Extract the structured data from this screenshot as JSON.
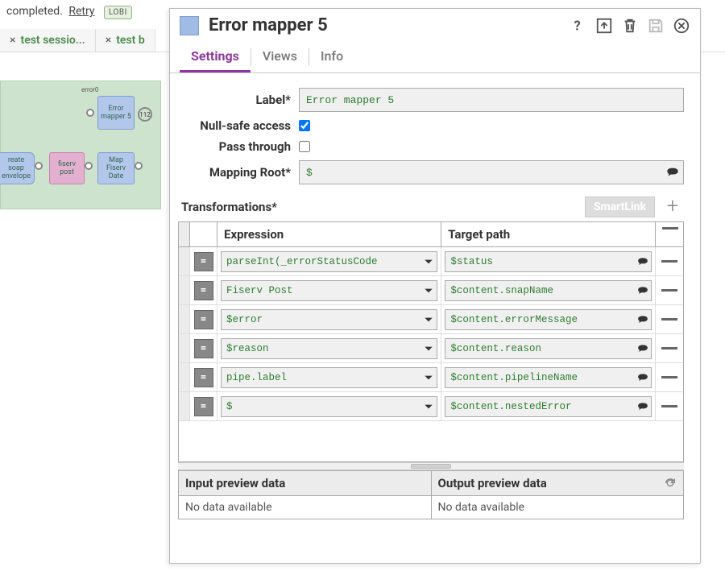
{
  "background": {
    "status_prefix": "completed.",
    "retry": "Retry",
    "lob_badge": "LOBI",
    "tabs": [
      {
        "label": "test sessio...",
        "closeable": true
      },
      {
        "label": "test b",
        "closeable": true
      }
    ],
    "pipeline": {
      "error_label": "error0",
      "nodes": {
        "error_mapper": "Error mapper 5",
        "badge": "112",
        "create_soap": "reate soap envelope",
        "fiserv_post": "fiserv post",
        "map_fiserv_date": "Map Fiserv Date"
      }
    }
  },
  "dialog": {
    "title": "Error mapper 5",
    "tabs": {
      "settings": "Settings",
      "views": "Views",
      "info": "Info"
    },
    "form": {
      "label_label": "Label*",
      "label_value": "Error mapper 5",
      "nullsafe_label": "Null-safe access",
      "nullsafe_checked": true,
      "passthrough_label": "Pass through",
      "passthrough_checked": false,
      "mappingroot_label": "Mapping Root*",
      "mappingroot_value": "$"
    },
    "transformations": {
      "title": "Transformations*",
      "smartlink": "SmartLink",
      "headers": {
        "expression": "Expression",
        "target": "Target path"
      },
      "rows": [
        {
          "expr": "parseInt(_errorStatusCode",
          "target": "$status"
        },
        {
          "expr": "Fiserv Post",
          "target": "$content.snapName"
        },
        {
          "expr": "$error",
          "target": "$content.errorMessage"
        },
        {
          "expr": "$reason",
          "target": "$content.reason"
        },
        {
          "expr": "pipe.label",
          "target": "$content.pipelineName"
        },
        {
          "expr": "$",
          "target": "$content.nestedError"
        }
      ]
    },
    "preview": {
      "input_title": "Input preview data",
      "output_title": "Output preview data",
      "input_body": "No data available",
      "output_body": "No data available"
    }
  }
}
